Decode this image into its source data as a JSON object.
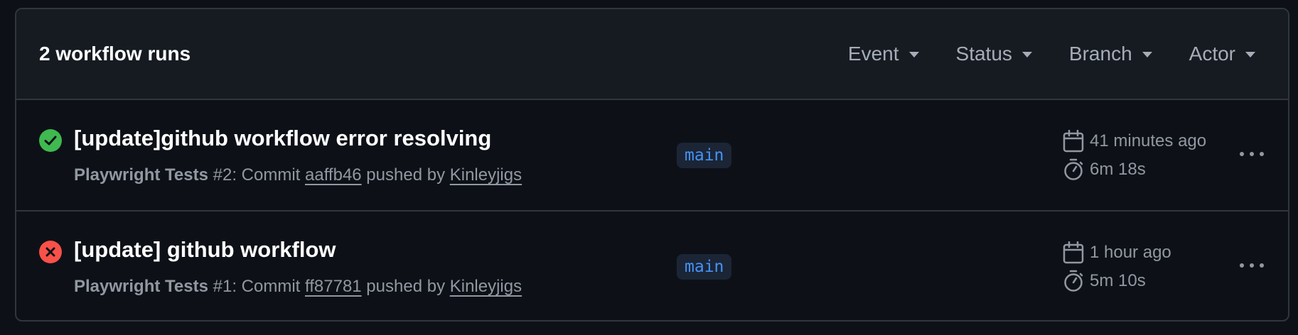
{
  "header": {
    "title": "2 workflow runs",
    "filters": [
      {
        "label": "Event"
      },
      {
        "label": "Status"
      },
      {
        "label": "Branch"
      },
      {
        "label": "Actor"
      }
    ]
  },
  "runs": [
    {
      "status": "success",
      "status_icon": "check-circle-icon",
      "title": "[update]github workflow error resolving",
      "workflow": "Playwright Tests",
      "run_number": "#2",
      "commit_prefix": ": Commit ",
      "commit": "aaffb46",
      "pushed_by_text": " pushed by ",
      "actor": "Kinleyjigs",
      "branch": "main",
      "started": "41 minutes ago",
      "duration": "6m 18s"
    },
    {
      "status": "failure",
      "status_icon": "x-circle-icon",
      "title": "[update] github workflow",
      "workflow": "Playwright Tests",
      "run_number": "#1",
      "commit_prefix": ": Commit ",
      "commit": "ff87781",
      "pushed_by_text": " pushed by ",
      "actor": "Kinleyjigs",
      "branch": "main",
      "started": "1 hour ago",
      "duration": "5m 10s"
    }
  ],
  "colors": {
    "success": "#3fb950",
    "failure": "#f85149",
    "branch_text": "#4493f8",
    "muted_text": "#9198a1"
  }
}
